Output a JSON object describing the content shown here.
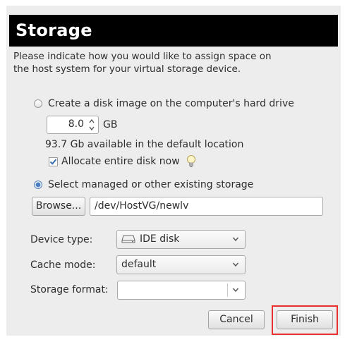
{
  "title": "Storage",
  "description": "Please indicate how you would like to assign space on the host system for your virtual storage device.",
  "create_option": {
    "label": "Create a disk image on the computer's hard drive",
    "selected": false,
    "size_value": "8.0",
    "size_unit": "GB",
    "available_text": "93.7 Gb available in the default location",
    "allocate_label": "Allocate entire disk now",
    "allocate_checked": true
  },
  "existing_option": {
    "label": "Select managed or other existing storage",
    "selected": true,
    "browse_label": "Browse...",
    "path_value": "/dev/HostVG/newlv"
  },
  "device_type": {
    "label": "Device type:",
    "value": "IDE disk",
    "icon": "disk-icon"
  },
  "cache_mode": {
    "label": "Cache mode:",
    "value": "default"
  },
  "storage_format": {
    "label": "Storage format:",
    "value": ""
  },
  "buttons": {
    "cancel": "Cancel",
    "finish": "Finish"
  },
  "colors": {
    "title_bg": "#000000",
    "title_fg": "#ffffff",
    "dialog_bg": "#ededed",
    "highlight": "#e8302f",
    "radio_selected": "#4a7cc0"
  }
}
